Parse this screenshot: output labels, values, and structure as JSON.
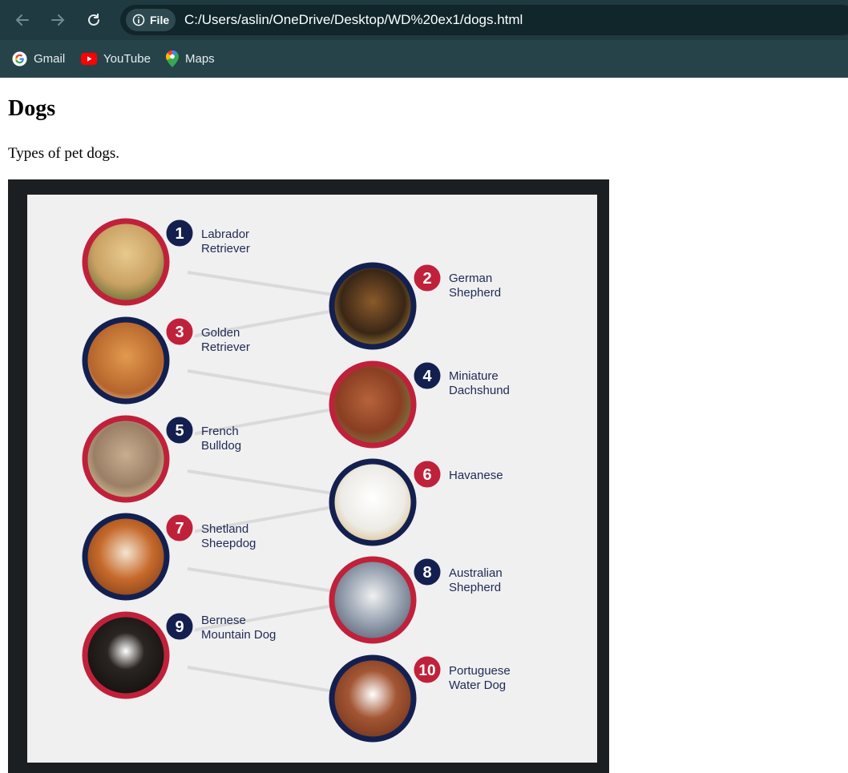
{
  "browser": {
    "url": "C:/Users/aslin/OneDrive/Desktop/WD%20ex1/dogs.html",
    "chip_label": "File",
    "bookmarks": [
      {
        "label": "Gmail",
        "icon": "google-icon"
      },
      {
        "label": "YouTube",
        "icon": "youtube-icon"
      },
      {
        "label": "Maps",
        "icon": "maps-icon"
      }
    ]
  },
  "page": {
    "title": "Dogs",
    "description": "Types of pet dogs."
  },
  "figure": {
    "dogs": [
      {
        "number": "1",
        "line1": "Labrador",
        "line2": "Retriever"
      },
      {
        "number": "2",
        "line1": "German",
        "line2": "Shepherd"
      },
      {
        "number": "3",
        "line1": "Golden",
        "line2": "Retriever"
      },
      {
        "number": "4",
        "line1": "Miniature",
        "line2": "Dachshund"
      },
      {
        "number": "5",
        "line1": "French",
        "line2": "Bulldog"
      },
      {
        "number": "6",
        "line1": "Havanese",
        "line2": ""
      },
      {
        "number": "7",
        "line1": "Shetland",
        "line2": "Sheepdog"
      },
      {
        "number": "8",
        "line1": "Australian",
        "line2": "Shepherd"
      },
      {
        "number": "9",
        "line1": "Bernese",
        "line2": "Mountain Dog"
      },
      {
        "number": "10",
        "line1": "Portuguese",
        "line2": "Water Dog"
      }
    ],
    "colors": {
      "red": "#c0213a",
      "navy": "#13204f"
    }
  }
}
